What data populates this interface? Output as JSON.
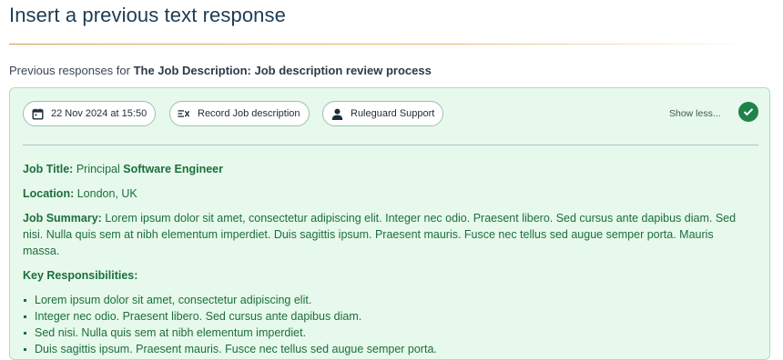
{
  "page": {
    "title": "Insert a previous text response",
    "subtitle_prefix": "Previous responses for ",
    "subtitle_bold": "The Job Description: Job description review process"
  },
  "response": {
    "date_label": "22 Nov 2024 at 15:50",
    "record_label": "Record Job description",
    "user_label": "Ruleguard Support",
    "show_less_label": "Show less...",
    "status": "selected",
    "icons": {
      "date": "calendar-icon",
      "record": "record-list-icon",
      "user": "person-icon",
      "status": "checkmark-circle-icon"
    },
    "colors": {
      "card_bg": "#e6f9ec",
      "card_border": "#a7e3b9",
      "text": "#1d6e3c",
      "check": "#1f8248"
    }
  },
  "content": {
    "job_title_label": "Job Title:",
    "job_title_value_plain": "Principal",
    "job_title_value_bold": "Software Engineer",
    "location_label": "Location:",
    "location_value": "London, UK",
    "summary_label": "Job Summary:",
    "summary_text": "Lorem ipsum dolor sit amet, consectetur adipiscing elit. Integer nec odio. Praesent libero. Sed cursus ante dapibus diam. Sed nisi. Nulla quis sem at nibh elementum imperdiet. Duis sagittis ipsum. Praesent mauris. Fusce nec tellus sed augue semper porta. Mauris massa.",
    "responsibilities_label": "Key Responsibilities:",
    "responsibilities": [
      "Lorem ipsum dolor sit amet, consectetur adipiscing elit.",
      "Integer nec odio. Praesent libero. Sed cursus ante dapibus diam.",
      "Sed nisi. Nulla quis sem at nibh elementum imperdiet.",
      "Duis sagittis ipsum. Praesent mauris. Fusce nec tellus sed augue semper porta."
    ]
  }
}
